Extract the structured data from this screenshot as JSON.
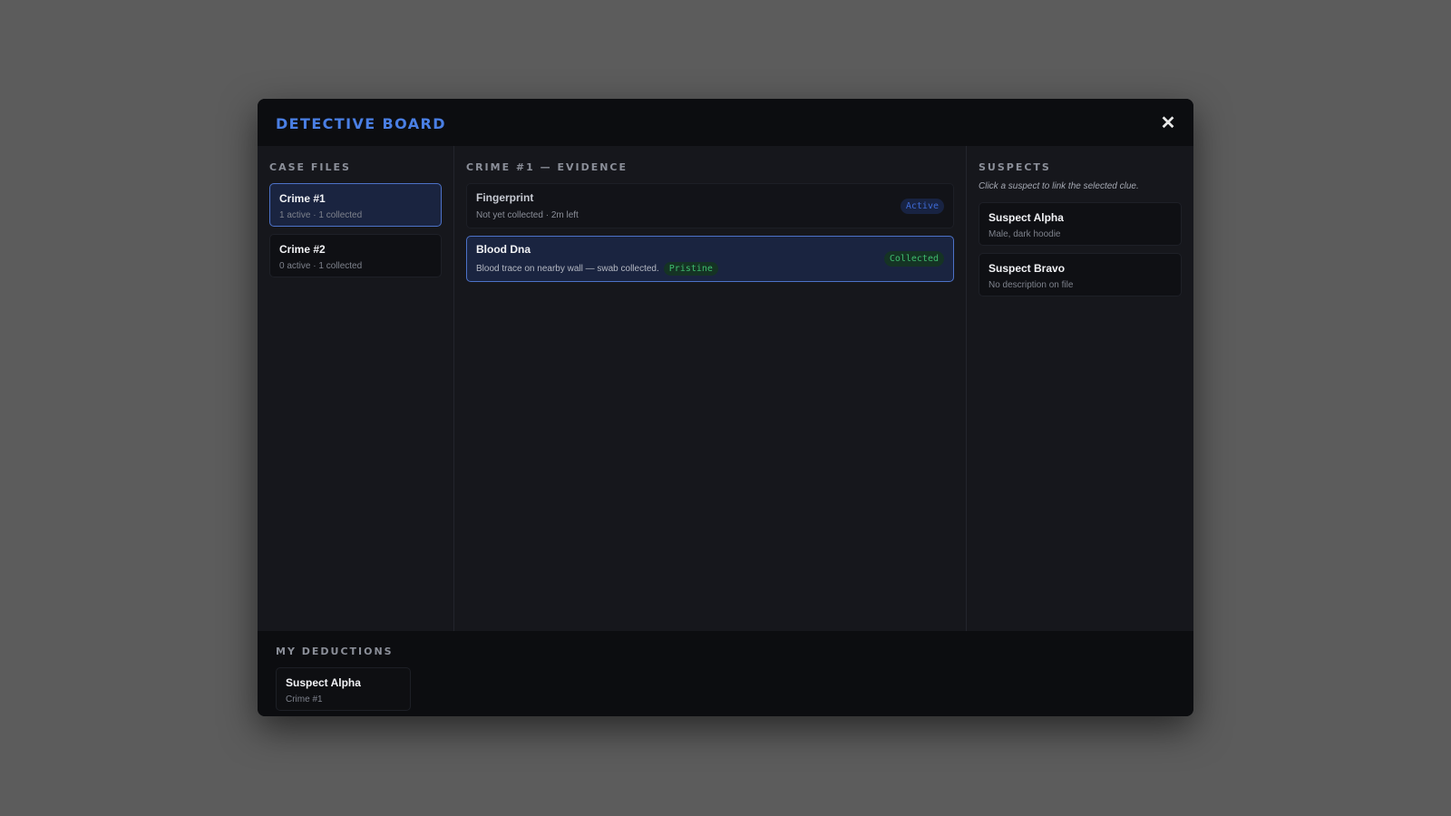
{
  "modal": {
    "title": "DETECTIVE BOARD",
    "close_label": "✕"
  },
  "cases": {
    "label": "CASE FILES",
    "items": [
      {
        "title": "Crime #1",
        "sub": "1 active · 1 collected",
        "selected": true
      },
      {
        "title": "Crime #2",
        "sub": "0 active · 1 collected",
        "selected": false
      }
    ]
  },
  "evidence": {
    "label": "CRIME #1 — EVIDENCE",
    "items": [
      {
        "title": "Fingerprint",
        "sub": "Not yet collected · 2m left",
        "badge": "Active",
        "selected": false
      },
      {
        "title": "Blood Dna",
        "sub": "Blood trace on nearby wall — swab collected.",
        "quality": "Pristine",
        "badge": "Collected",
        "selected": true
      }
    ]
  },
  "suspects": {
    "label": "SUSPECTS",
    "hint": "Click a suspect to link the selected clue.",
    "items": [
      {
        "name": "Suspect Alpha",
        "desc": "Male, dark hoodie"
      },
      {
        "name": "Suspect Bravo",
        "desc": "No description on file"
      }
    ]
  },
  "deductions": {
    "label": "MY DEDUCTIONS",
    "items": [
      {
        "suspect": "Suspect Alpha",
        "crime": "Crime #1"
      }
    ]
  },
  "colors": {
    "accent": "#4a7fe4",
    "active_badge": "#3e6ad6",
    "collected_badge": "#3fbc6e",
    "backdrop": "#5c5c5c"
  }
}
